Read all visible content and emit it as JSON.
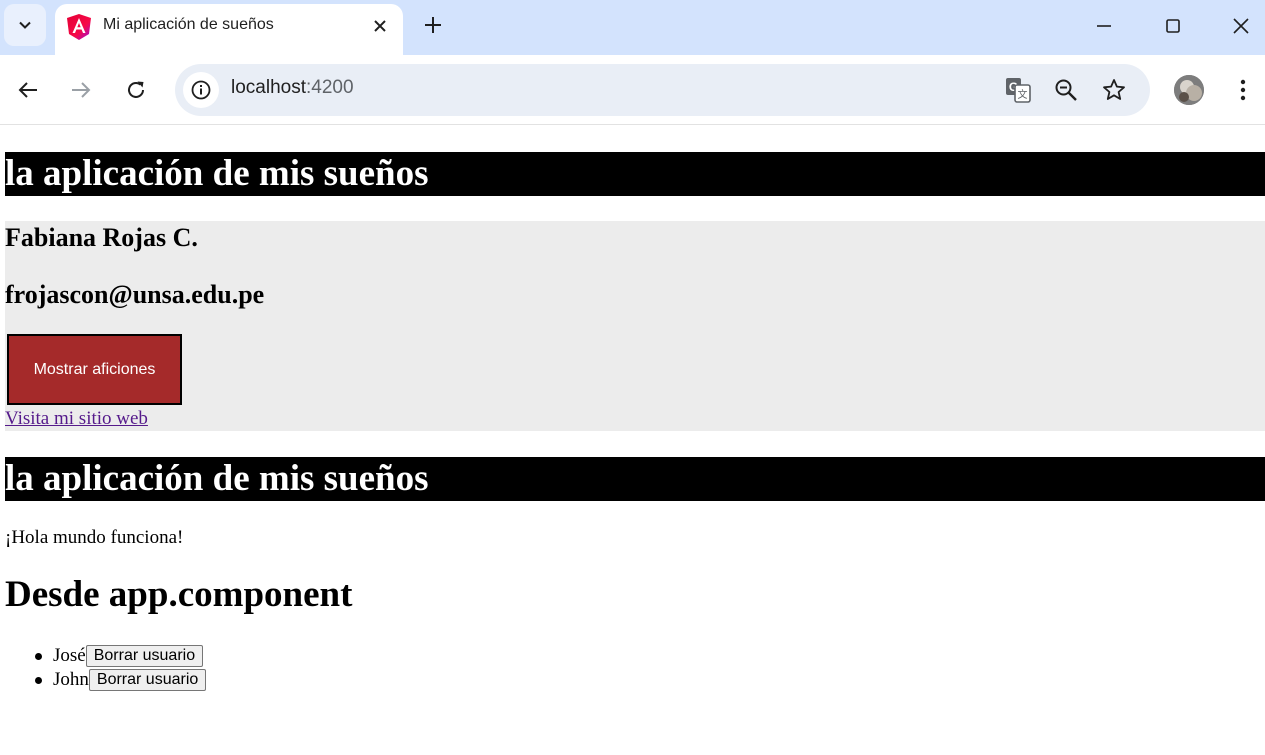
{
  "browser": {
    "tab_title": "Mi aplicación de sueños",
    "url_host": "localhost",
    "url_port": ":4200",
    "accent_color": "#d3e3fd",
    "icons": [
      "tab-search-icon",
      "angular-favicon-icon",
      "close-tab-icon",
      "new-tab-icon",
      "minimize-icon",
      "maximize-icon",
      "close-window-icon",
      "back-icon",
      "forward-icon",
      "reload-icon",
      "site-info-icon",
      "translate-icon",
      "zoom-icon",
      "bookmark-star-icon",
      "profile-avatar",
      "more-menu-icon"
    ]
  },
  "page": {
    "banner_title": "la aplicación de mis sueños",
    "card": {
      "name": "Fabiana Rojas C.",
      "email": "frojascon@unsa.edu.pe",
      "button_label": "Mostrar aficiones",
      "button_color": "#a52a2a",
      "link_text": "Visita mi sitio web",
      "background": "#ececec"
    },
    "banner_title_2": "la aplicación de mis sueños",
    "hello_text": "¡Hola mundo funciona!",
    "section_heading": "Desde app.component",
    "users": [
      {
        "name": "José",
        "button_label": "Borrar usuario"
      },
      {
        "name": "John",
        "button_label": "Borrar usuario"
      }
    ]
  }
}
